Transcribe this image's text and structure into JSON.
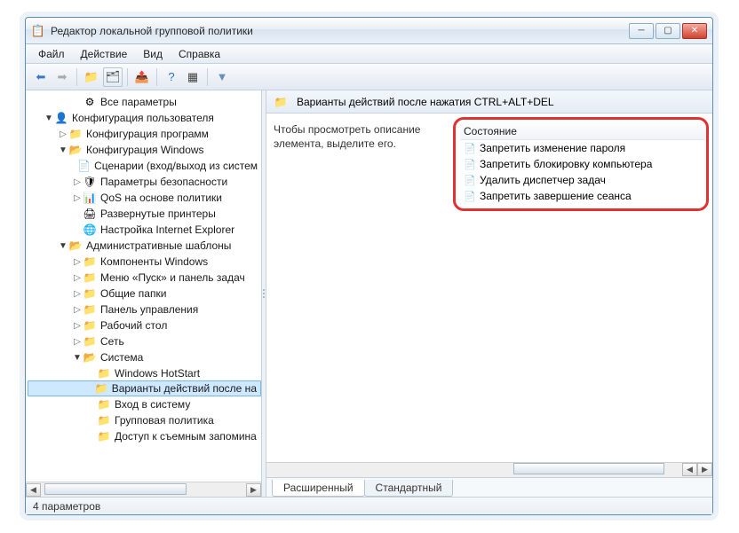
{
  "window": {
    "title": "Редактор локальной групповой политики"
  },
  "menubar": {
    "items": [
      "Файл",
      "Действие",
      "Вид",
      "Справка"
    ]
  },
  "tree": {
    "items": [
      {
        "depth": 2,
        "tri": "",
        "icon": "⚙",
        "label": "Все параметры"
      },
      {
        "depth": 0,
        "tri": "▼",
        "icon": "👤",
        "label": "Конфигурация пользователя"
      },
      {
        "depth": 1,
        "tri": "▷",
        "icon": "📁",
        "label": "Конфигурация программ"
      },
      {
        "depth": 1,
        "tri": "▼",
        "icon": "📂",
        "label": "Конфигурация Windows"
      },
      {
        "depth": 2,
        "tri": "",
        "icon": "📄",
        "label": "Сценарии (вход/выход из систем"
      },
      {
        "depth": 2,
        "tri": "▷",
        "icon": "🛡",
        "label": "Параметры безопасности"
      },
      {
        "depth": 2,
        "tri": "▷",
        "icon": "📊",
        "label": "QoS на основе политики"
      },
      {
        "depth": 2,
        "tri": "",
        "icon": "🖨",
        "label": "Развернутые принтеры"
      },
      {
        "depth": 2,
        "tri": "",
        "icon": "🌐",
        "label": "Настройка Internet Explorer"
      },
      {
        "depth": 1,
        "tri": "▼",
        "icon": "📂",
        "label": "Административные шаблоны"
      },
      {
        "depth": 2,
        "tri": "▷",
        "icon": "📁",
        "label": "Компоненты Windows"
      },
      {
        "depth": 2,
        "tri": "▷",
        "icon": "📁",
        "label": "Меню «Пуск» и панель задач"
      },
      {
        "depth": 2,
        "tri": "▷",
        "icon": "📁",
        "label": "Общие папки"
      },
      {
        "depth": 2,
        "tri": "▷",
        "icon": "📁",
        "label": "Панель управления"
      },
      {
        "depth": 2,
        "tri": "▷",
        "icon": "📁",
        "label": "Рабочий стол"
      },
      {
        "depth": 2,
        "tri": "▷",
        "icon": "📁",
        "label": "Сеть"
      },
      {
        "depth": 2,
        "tri": "▼",
        "icon": "📂",
        "label": "Система"
      },
      {
        "depth": 3,
        "tri": "",
        "icon": "📁",
        "label": "Windows HotStart"
      },
      {
        "depth": 3,
        "tri": "",
        "icon": "📁",
        "label": "Варианты действий после на",
        "sel": true
      },
      {
        "depth": 3,
        "tri": "",
        "icon": "📁",
        "label": "Вход в систему"
      },
      {
        "depth": 3,
        "tri": "",
        "icon": "📁",
        "label": "Групповая политика"
      },
      {
        "depth": 3,
        "tri": "",
        "icon": "📁",
        "label": "Доступ к съемным запомина"
      }
    ]
  },
  "content": {
    "header": "Варианты действий после нажатия CTRL+ALT+DEL",
    "description": "Чтобы просмотреть описание элемента, выделите его.",
    "column": "Состояние",
    "items": [
      "Запретить изменение пароля",
      "Запретить блокировку компьютера",
      "Удалить диспетчер задач",
      "Запретить завершение сеанса"
    ]
  },
  "tabs": {
    "items": [
      "Расширенный",
      "Стандартный"
    ],
    "active": 0
  },
  "statusbar": {
    "text": "4 параметров"
  }
}
